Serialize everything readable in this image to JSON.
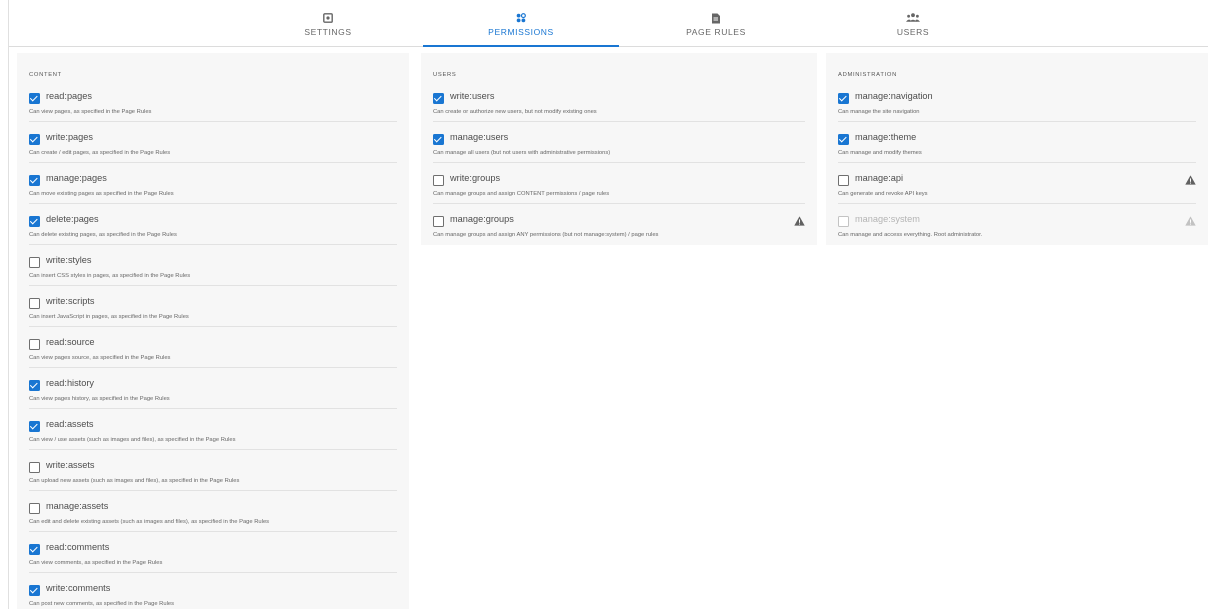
{
  "tabs": [
    {
      "label": "SETTINGS",
      "icon": "settings-icon"
    },
    {
      "label": "PERMISSIONS",
      "icon": "permissions-icon",
      "active": true
    },
    {
      "label": "PAGE RULES",
      "icon": "page-rules-icon"
    },
    {
      "label": "USERS",
      "icon": "users-icon"
    }
  ],
  "colors": {
    "accent": "#1976d2",
    "warning": "#616161"
  },
  "content": {
    "title": "CONTENT",
    "items": [
      {
        "name": "read:pages",
        "desc": "Can view pages, as specified in the Page Rules",
        "checked": true
      },
      {
        "name": "write:pages",
        "desc": "Can create / edit pages, as specified in the Page Rules",
        "checked": true
      },
      {
        "name": "manage:pages",
        "desc": "Can move existing pages as specified in the Page Rules",
        "checked": true
      },
      {
        "name": "delete:pages",
        "desc": "Can delete existing pages, as specified in the Page Rules",
        "checked": true
      },
      {
        "name": "write:styles",
        "desc": "Can insert CSS styles in pages, as specified in the Page Rules",
        "checked": false
      },
      {
        "name": "write:scripts",
        "desc": "Can insert JavaScript in pages, as specified in the Page Rules",
        "checked": false
      },
      {
        "name": "read:source",
        "desc": "Can view pages source, as specified in the Page Rules",
        "checked": false
      },
      {
        "name": "read:history",
        "desc": "Can view pages history, as specified in the Page Rules",
        "checked": true
      },
      {
        "name": "read:assets",
        "desc": "Can view / use assets (such as images and files), as specified in the Page Rules",
        "checked": true
      },
      {
        "name": "write:assets",
        "desc": "Can upload new assets (such as images and files), as specified in the Page Rules",
        "checked": false
      },
      {
        "name": "manage:assets",
        "desc": "Can edit and delete existing assets (such as images and files), as specified in the Page Rules",
        "checked": false
      },
      {
        "name": "read:comments",
        "desc": "Can view comments, as specified in the Page Rules",
        "checked": true
      },
      {
        "name": "write:comments",
        "desc": "Can post new comments, as specified in the Page Rules",
        "checked": true
      }
    ]
  },
  "users": {
    "title": "USERS",
    "items": [
      {
        "name": "write:users",
        "desc": "Can create or authorize new users, but not modify existing ones",
        "checked": true
      },
      {
        "name": "manage:users",
        "desc": "Can manage all users (but not users with administrative permissions)",
        "checked": true
      },
      {
        "name": "write:groups",
        "desc": "Can manage groups and assign CONTENT permissions / page rules",
        "checked": false
      },
      {
        "name": "manage:groups",
        "desc": "Can manage groups and assign ANY permissions (but not manage:system) / page rules",
        "checked": false,
        "warning": true
      }
    ]
  },
  "administration": {
    "title": "ADMINISTRATION",
    "items": [
      {
        "name": "manage:navigation",
        "desc": "Can manage the site navigation",
        "checked": true
      },
      {
        "name": "manage:theme",
        "desc": "Can manage and modify themes",
        "checked": true
      },
      {
        "name": "manage:api",
        "desc": "Can generate and revoke API keys",
        "checked": false,
        "warning": true
      },
      {
        "name": "manage:system",
        "desc": "Can manage and access everything. Root administrator.",
        "checked": false,
        "warning": true,
        "disabled": true
      }
    ]
  }
}
